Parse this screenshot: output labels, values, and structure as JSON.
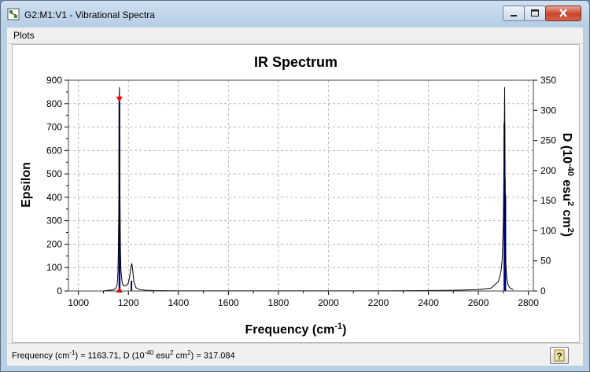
{
  "window": {
    "title": "G2:M1:V1 - Vibrational Spectra",
    "menu": [
      "Plots"
    ]
  },
  "status": {
    "freq_label": "Frequency (cm",
    "freq_exp": "-1",
    "freq_value": ") = 1163.71, D (10",
    "d_exp": "-40",
    "d_unit": " esu",
    "d_sq": "2",
    "d_cm": " cm",
    "d_sq2": "2",
    "d_value": ") = 317.084"
  },
  "colors": {
    "curve": "#000000",
    "sticks": "#000080",
    "marker": "#ff0000",
    "grid": "#b8b8b8"
  },
  "chart_data": {
    "type": "line",
    "title": "IR Spectrum",
    "xlabel": "Frequency (cm-1)",
    "xlabel_main": "Frequency (cm",
    "xlabel_exp": "-1",
    "xlabel_tail": ")",
    "ylabel": "Epsilon",
    "y2label_parts": [
      "D (10",
      "-40",
      " esu",
      "2",
      " cm",
      "2",
      ")"
    ],
    "xlim": [
      960,
      2820
    ],
    "ylim": [
      0,
      900
    ],
    "y2lim": [
      0,
      350
    ],
    "xticks": [
      1000,
      1200,
      1400,
      1600,
      1800,
      2000,
      2200,
      2400,
      2600,
      2800
    ],
    "yticks": [
      0,
      100,
      200,
      300,
      400,
      500,
      600,
      700,
      800,
      900
    ],
    "y2ticks": [
      0,
      50,
      100,
      150,
      200,
      250,
      300,
      350
    ],
    "grid": true,
    "series": [
      {
        "kind": "curve",
        "x": [
          1100,
          1140,
          1150,
          1155,
          1158,
          1160,
          1162,
          1163,
          1164,
          1165,
          1166,
          1168,
          1170,
          1175,
          1180,
          1190,
          1200,
          1205,
          1210,
          1213,
          1215,
          1218,
          1222,
          1230,
          1245,
          1270,
          1300,
          1400,
          1600,
          1800,
          2000,
          2200,
          2400,
          2500,
          2600,
          2650,
          2680,
          2690,
          2695,
          2700,
          2702,
          2704,
          2705,
          2706,
          2707,
          2708,
          2710,
          2713,
          2718,
          2725,
          2740
        ],
        "y": [
          1,
          5,
          12,
          30,
          80,
          180,
          400,
          800,
          870,
          800,
          400,
          180,
          90,
          35,
          22,
          22,
          35,
          60,
          100,
          118,
          110,
          80,
          40,
          14,
          6,
          3,
          2,
          1,
          1,
          1,
          1,
          1,
          2,
          3,
          6,
          12,
          40,
          80,
          130,
          300,
          500,
          700,
          870,
          700,
          450,
          250,
          120,
          60,
          30,
          14,
          5
        ]
      },
      {
        "kind": "sticks",
        "axis": "D",
        "x": [
          1163.7,
          1165,
          1212,
          2704,
          2706,
          2708
        ],
        "y": [
          317.084,
          92,
          17,
          278,
          186,
          160
        ]
      }
    ],
    "marker": {
      "x": 1163.71,
      "y": 817
    }
  }
}
